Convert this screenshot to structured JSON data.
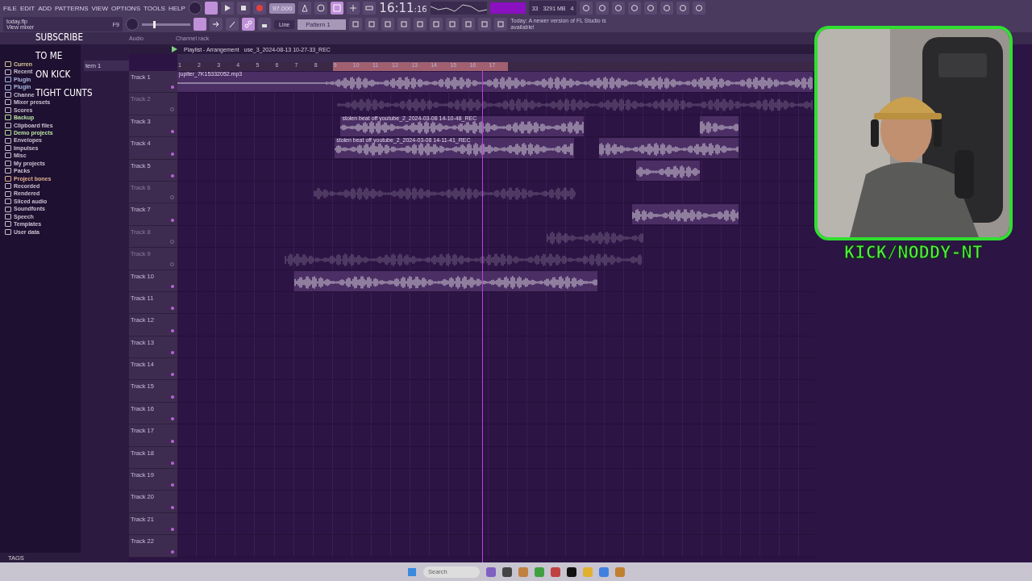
{
  "menu": [
    "FILE",
    "EDIT",
    "ADD",
    "PATTERNS",
    "VIEW",
    "OPTIONS",
    "TOOLS",
    "HELP"
  ],
  "hint": {
    "file": "today.flp",
    "action": "View mixer",
    "shortcut": "F9"
  },
  "transport": {
    "tempo": "97.000",
    "clock": "16:11",
    "clock_seconds": ":16"
  },
  "cpu": {
    "polyphony": "33",
    "memory": "3291 MB",
    "voices": "4"
  },
  "master": {
    "level": 0.25
  },
  "snap": "Line",
  "pattern": "Pattern 1",
  "news": "Today: A newer version of FL Studio is available!",
  "tabs": [
    "Audio",
    "Channel rack"
  ],
  "overlay_text": [
    "SUBSCRIBE",
    "TO ME",
    "ON KICK",
    "TIGHT CUNTS"
  ],
  "browser": {
    "items": [
      {
        "label": "Curren",
        "color": "#d8c898"
      },
      {
        "label": "Recent",
        "color": "#c8c0d0"
      },
      {
        "label": "Plugin",
        "color": "#a8b8e0"
      },
      {
        "label": "Plugin",
        "color": "#a8b8e0"
      },
      {
        "label": "Channe",
        "color": "#c8c0d0"
      },
      {
        "label": "Mixer presets",
        "color": "#c8c0d0"
      },
      {
        "label": "Scores",
        "color": "#c8c0d0"
      },
      {
        "label": "Backup",
        "color": "#b8e0a0"
      },
      {
        "label": "Clipboard files",
        "color": "#c8c0d0"
      },
      {
        "label": "Demo projects",
        "color": "#b8e0a0"
      },
      {
        "label": "Envelopes",
        "color": "#c8c0d0"
      },
      {
        "label": "Impulses",
        "color": "#c8c0d0"
      },
      {
        "label": "Misc",
        "color": "#c8c0d0"
      },
      {
        "label": "My projects",
        "color": "#c8c0d0"
      },
      {
        "label": "Packs",
        "color": "#c8c0d0"
      },
      {
        "label": "Project bones",
        "color": "#e0b090"
      },
      {
        "label": "Recorded",
        "color": "#c8c0d0"
      },
      {
        "label": "Rendered",
        "color": "#c8c0d0"
      },
      {
        "label": "Sliced audio",
        "color": "#c8c0d0"
      },
      {
        "label": "Soundfonts",
        "color": "#c8c0d0"
      },
      {
        "label": "Speech",
        "color": "#c8c0d0"
      },
      {
        "label": "Templates",
        "color": "#c8c0d0"
      },
      {
        "label": "User data",
        "color": "#c8c0d0"
      }
    ],
    "footer": "TAGS"
  },
  "channel_rack": {
    "pattern": "tern 1"
  },
  "playlist": {
    "title": "Playlist - Arrangement",
    "clip": "use_3_2024-08-13 10-27-33_REC",
    "ruler": [
      "1",
      "2",
      "3",
      "4",
      "5",
      "6",
      "7",
      "8",
      "9",
      "10",
      "11",
      "12",
      "13",
      "14",
      "15",
      "16",
      "17"
    ],
    "tracks": [
      {
        "name": "Track 1",
        "muted": false,
        "clips": [
          {
            "kind": "audio",
            "label": "jupiter_7K15332052.mp3"
          }
        ]
      },
      {
        "name": "Track 2",
        "muted": true,
        "clips": [
          {
            "kind": "audio"
          }
        ]
      },
      {
        "name": "Track 3",
        "muted": false,
        "clips": [
          {
            "kind": "audio",
            "label": "stolen beat off youtube_2_2024-03-08 14-10-48_REC"
          },
          {
            "kind": "audio"
          }
        ]
      },
      {
        "name": "Track 4",
        "muted": false,
        "clips": [
          {
            "kind": "audio",
            "label": "stolen beat off youtube_2_2024-03-08 14-11-41_REC"
          },
          {
            "kind": "audio"
          }
        ]
      },
      {
        "name": "Track 5",
        "muted": false,
        "clips": [
          {
            "kind": "audio"
          }
        ]
      },
      {
        "name": "Track 6",
        "muted": true,
        "clips": [
          {
            "kind": "audio"
          }
        ]
      },
      {
        "name": "Track 7",
        "muted": false,
        "clips": [
          {
            "kind": "audio"
          }
        ]
      },
      {
        "name": "Track 8",
        "muted": true,
        "clips": [
          {
            "kind": "audio"
          }
        ]
      },
      {
        "name": "Track 9",
        "muted": true,
        "clips": [
          {
            "kind": "audio"
          }
        ]
      },
      {
        "name": "Track 10",
        "muted": false,
        "clips": [
          {
            "kind": "audio"
          }
        ]
      },
      {
        "name": "Track 11",
        "muted": false
      },
      {
        "name": "Track 12",
        "muted": false
      },
      {
        "name": "Track 13",
        "muted": false
      },
      {
        "name": "Track 14",
        "muted": false
      },
      {
        "name": "Track 15",
        "muted": false
      },
      {
        "name": "Track 16",
        "muted": false
      },
      {
        "name": "Track 17",
        "muted": false
      },
      {
        "name": "Track 18",
        "muted": false
      },
      {
        "name": "Track 19",
        "muted": false
      },
      {
        "name": "Track 20",
        "muted": false
      },
      {
        "name": "Track 21",
        "muted": false
      },
      {
        "name": "Track 22",
        "muted": false
      }
    ]
  },
  "webcam": {
    "kind": "picture",
    "caption": "KICK/NODDY-NT"
  },
  "taskbar": {
    "search": "Search"
  }
}
